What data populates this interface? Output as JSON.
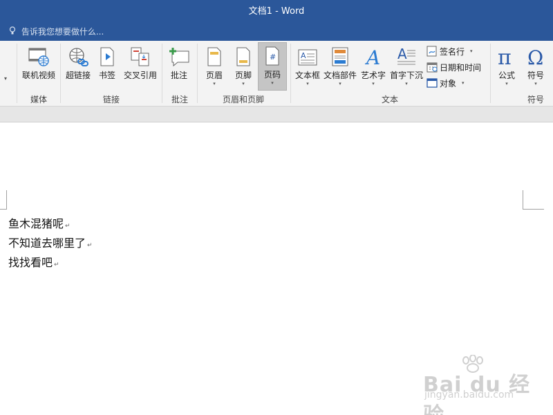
{
  "window": {
    "title": "文档1 - Word"
  },
  "tell_me": {
    "placeholder": "告诉我您想要做什么..."
  },
  "ribbon": {
    "groups": {
      "media": {
        "label": "媒体",
        "online_video": "联机视频"
      },
      "links": {
        "label": "链接",
        "hyperlink": "超链接",
        "bookmark": "书签",
        "cross_reference": "交叉引用"
      },
      "comments": {
        "label": "批注",
        "comment": "批注"
      },
      "header_footer": {
        "label": "页眉和页脚",
        "header": "页眉",
        "footer": "页脚",
        "page_number": "页码"
      },
      "text": {
        "label": "文本",
        "text_box": "文本框",
        "quick_parts": "文档部件",
        "wordart": "艺术字",
        "drop_cap": "首字下沉",
        "signature_line": "签名行",
        "date_time": "日期和时间",
        "object": "对象"
      },
      "symbols": {
        "label": "符号",
        "equation": "公式",
        "symbol": "符号"
      }
    },
    "caret": "▾"
  },
  "document": {
    "lines": [
      "鱼木混猪呢",
      "不知道去哪里了",
      "找找看吧"
    ],
    "paragraph_mark": "↵"
  },
  "watermark": {
    "brand": "Bai du 经验",
    "url": "jingyan.baidu.com"
  },
  "colors": {
    "title_bar": "#2b579a",
    "ribbon_bg": "#f3f3f3",
    "active_button": "#c5c5c5"
  }
}
